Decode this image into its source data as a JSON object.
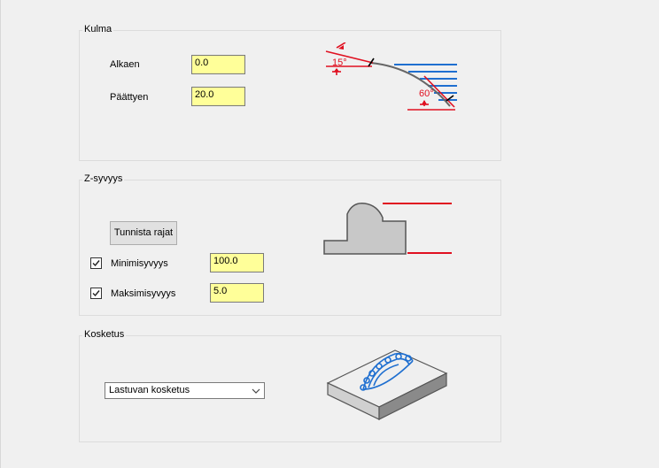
{
  "kulma": {
    "title": "Kulma",
    "alkaen_label": "Alkaen",
    "alkaen_value": "0.0",
    "paattyen_label": "Päättyen",
    "paattyen_value": "20.0",
    "diagram_start_angle": "15°",
    "diagram_end_angle": "60°"
  },
  "z_syvyys": {
    "title": "Z-syvyys",
    "detect_button": "Tunnista rajat",
    "min_checked": true,
    "min_label": "Minimisyvyys",
    "min_value": "100.0",
    "max_checked": true,
    "max_label": "Maksimisyvyys",
    "max_value": "5.0"
  },
  "kosketus": {
    "title": "Kosketus",
    "selected_option": "Lastuvan kosketus"
  },
  "colors": {
    "field_bg": "#ffff99",
    "red": "#e01020",
    "blue": "#1f6fd0"
  }
}
